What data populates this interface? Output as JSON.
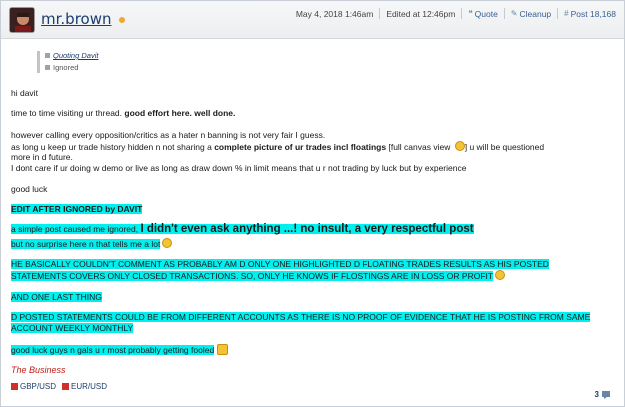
{
  "header": {
    "username": "mr.brown",
    "date": "May 4, 2018 1:46am",
    "edited": "Edited at 12:46pm",
    "quote_label": "Quote",
    "cleanup_label": "Cleanup",
    "post_label": "Post 18,168"
  },
  "quote": {
    "author": "Quoting Davit",
    "status": "Ignored"
  },
  "body": {
    "l1": "hi davit",
    "l2a": "time to time visiting ur thread. ",
    "l2b": "good effort here. well done.",
    "l3": "however calling every opposition/critics as a hater n banning is not very fair I guess.",
    "l4a": "as long u keep ur trade history hidden n not sharing a ",
    "l4b": "complete picture of ur trades incl floatings",
    "l4c": " [full canvas view ",
    "l4d": "] u will be questioned",
    "l5": "more in d future.",
    "l6": "I dont care if ur doing w demo or live as long as draw down % in limit means that u r not trading by luck but by experience",
    "l7": "good luck",
    "l8": "EDIT AFTER IGNORED by DAVIT",
    "l9a": "a simple post caused me ignored, ",
    "l9b": "I didn't even ask anything ...! no insult, a very respectful post",
    "l10": "but no surprise here n that tells me a lot",
    "l11": "HE BASICALLY COULDN'T COMMENT AS PROBABLY AM D ONLY ONE HIGHLIGHTED D FLOATING TRADES RESULTS AS HIS POSTED",
    "l12": "STATEMENTS COVERS ONLY CLOSED TRANSACTIONS. SO, ONLY HE KNOWS IF FLOSTINGS ARE IN LOSS OR PROFIT",
    "l13": "AND ONE LAST THING",
    "l14": "D POSTED STATEMENTS COULD BE FROM DIFFERENT ACCOUNTS AS THERE IS NO PROOF OF EVIDENCE THAT HE IS POSTING FROM SAME",
    "l15": "ACCOUNT WEEKLY MONTHLY",
    "l16": "good luck guys n gals u r most probably getting fooled"
  },
  "signature": "The Business",
  "pairs": [
    "GBP/USD",
    "EUR/USD"
  ],
  "reply_count": "3",
  "colors": {
    "highlight": "#00f0f0",
    "link": "#1c3d6e",
    "signature": "#c0201a"
  }
}
